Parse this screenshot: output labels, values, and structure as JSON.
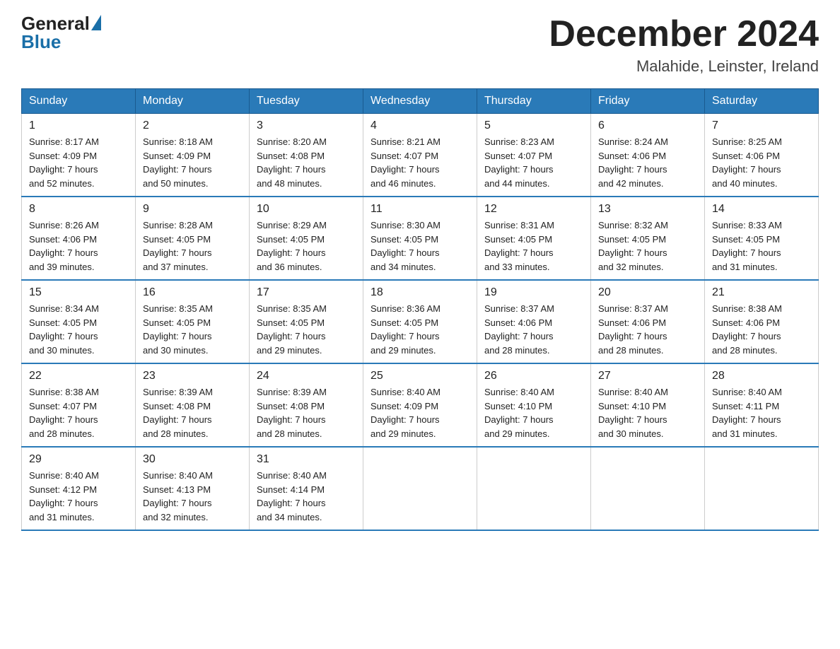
{
  "logo": {
    "general": "General",
    "blue": "Blue"
  },
  "title": "December 2024",
  "location": "Malahide, Leinster, Ireland",
  "headers": [
    "Sunday",
    "Monday",
    "Tuesday",
    "Wednesday",
    "Thursday",
    "Friday",
    "Saturday"
  ],
  "weeks": [
    [
      {
        "day": "1",
        "info": "Sunrise: 8:17 AM\nSunset: 4:09 PM\nDaylight: 7 hours\nand 52 minutes."
      },
      {
        "day": "2",
        "info": "Sunrise: 8:18 AM\nSunset: 4:09 PM\nDaylight: 7 hours\nand 50 minutes."
      },
      {
        "day": "3",
        "info": "Sunrise: 8:20 AM\nSunset: 4:08 PM\nDaylight: 7 hours\nand 48 minutes."
      },
      {
        "day": "4",
        "info": "Sunrise: 8:21 AM\nSunset: 4:07 PM\nDaylight: 7 hours\nand 46 minutes."
      },
      {
        "day": "5",
        "info": "Sunrise: 8:23 AM\nSunset: 4:07 PM\nDaylight: 7 hours\nand 44 minutes."
      },
      {
        "day": "6",
        "info": "Sunrise: 8:24 AM\nSunset: 4:06 PM\nDaylight: 7 hours\nand 42 minutes."
      },
      {
        "day": "7",
        "info": "Sunrise: 8:25 AM\nSunset: 4:06 PM\nDaylight: 7 hours\nand 40 minutes."
      }
    ],
    [
      {
        "day": "8",
        "info": "Sunrise: 8:26 AM\nSunset: 4:06 PM\nDaylight: 7 hours\nand 39 minutes."
      },
      {
        "day": "9",
        "info": "Sunrise: 8:28 AM\nSunset: 4:05 PM\nDaylight: 7 hours\nand 37 minutes."
      },
      {
        "day": "10",
        "info": "Sunrise: 8:29 AM\nSunset: 4:05 PM\nDaylight: 7 hours\nand 36 minutes."
      },
      {
        "day": "11",
        "info": "Sunrise: 8:30 AM\nSunset: 4:05 PM\nDaylight: 7 hours\nand 34 minutes."
      },
      {
        "day": "12",
        "info": "Sunrise: 8:31 AM\nSunset: 4:05 PM\nDaylight: 7 hours\nand 33 minutes."
      },
      {
        "day": "13",
        "info": "Sunrise: 8:32 AM\nSunset: 4:05 PM\nDaylight: 7 hours\nand 32 minutes."
      },
      {
        "day": "14",
        "info": "Sunrise: 8:33 AM\nSunset: 4:05 PM\nDaylight: 7 hours\nand 31 minutes."
      }
    ],
    [
      {
        "day": "15",
        "info": "Sunrise: 8:34 AM\nSunset: 4:05 PM\nDaylight: 7 hours\nand 30 minutes."
      },
      {
        "day": "16",
        "info": "Sunrise: 8:35 AM\nSunset: 4:05 PM\nDaylight: 7 hours\nand 30 minutes."
      },
      {
        "day": "17",
        "info": "Sunrise: 8:35 AM\nSunset: 4:05 PM\nDaylight: 7 hours\nand 29 minutes."
      },
      {
        "day": "18",
        "info": "Sunrise: 8:36 AM\nSunset: 4:05 PM\nDaylight: 7 hours\nand 29 minutes."
      },
      {
        "day": "19",
        "info": "Sunrise: 8:37 AM\nSunset: 4:06 PM\nDaylight: 7 hours\nand 28 minutes."
      },
      {
        "day": "20",
        "info": "Sunrise: 8:37 AM\nSunset: 4:06 PM\nDaylight: 7 hours\nand 28 minutes."
      },
      {
        "day": "21",
        "info": "Sunrise: 8:38 AM\nSunset: 4:06 PM\nDaylight: 7 hours\nand 28 minutes."
      }
    ],
    [
      {
        "day": "22",
        "info": "Sunrise: 8:38 AM\nSunset: 4:07 PM\nDaylight: 7 hours\nand 28 minutes."
      },
      {
        "day": "23",
        "info": "Sunrise: 8:39 AM\nSunset: 4:08 PM\nDaylight: 7 hours\nand 28 minutes."
      },
      {
        "day": "24",
        "info": "Sunrise: 8:39 AM\nSunset: 4:08 PM\nDaylight: 7 hours\nand 28 minutes."
      },
      {
        "day": "25",
        "info": "Sunrise: 8:40 AM\nSunset: 4:09 PM\nDaylight: 7 hours\nand 29 minutes."
      },
      {
        "day": "26",
        "info": "Sunrise: 8:40 AM\nSunset: 4:10 PM\nDaylight: 7 hours\nand 29 minutes."
      },
      {
        "day": "27",
        "info": "Sunrise: 8:40 AM\nSunset: 4:10 PM\nDaylight: 7 hours\nand 30 minutes."
      },
      {
        "day": "28",
        "info": "Sunrise: 8:40 AM\nSunset: 4:11 PM\nDaylight: 7 hours\nand 31 minutes."
      }
    ],
    [
      {
        "day": "29",
        "info": "Sunrise: 8:40 AM\nSunset: 4:12 PM\nDaylight: 7 hours\nand 31 minutes."
      },
      {
        "day": "30",
        "info": "Sunrise: 8:40 AM\nSunset: 4:13 PM\nDaylight: 7 hours\nand 32 minutes."
      },
      {
        "day": "31",
        "info": "Sunrise: 8:40 AM\nSunset: 4:14 PM\nDaylight: 7 hours\nand 34 minutes."
      },
      {
        "day": "",
        "info": ""
      },
      {
        "day": "",
        "info": ""
      },
      {
        "day": "",
        "info": ""
      },
      {
        "day": "",
        "info": ""
      }
    ]
  ]
}
